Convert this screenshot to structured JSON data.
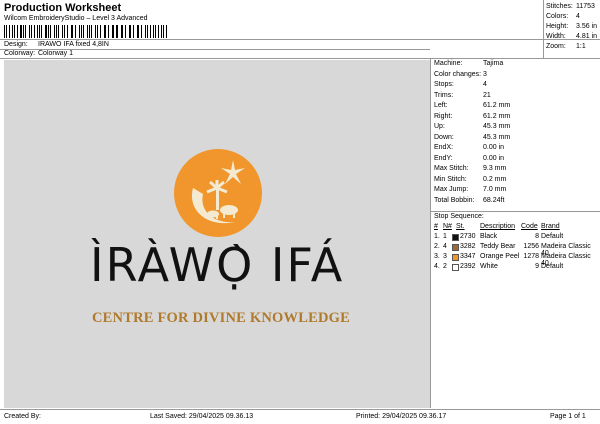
{
  "header": {
    "title": "Production Worksheet",
    "subtitle": "Wilcom EmbroideryStudio – Level 3 Advanced",
    "design_label": "Design:",
    "design_value": "IRAWO IFA fixed 4,8IN",
    "colorway_label": "Colorway:",
    "colorway_value": "Colorway 1"
  },
  "summary": [
    {
      "label": "Stitches:",
      "value": "11753"
    },
    {
      "label": "Colors:",
      "value": "4"
    },
    {
      "label": "Height:",
      "value": "3.56 in"
    },
    {
      "label": "Width:",
      "value": "4.81 in"
    },
    {
      "label": "Zoom:",
      "value": "1:1"
    }
  ],
  "design": {
    "logo_text": "ÌRÀWỌ̀ IFÁ",
    "tagline": "CENTRE FOR DIVINE KNOWLEDGE",
    "colors": {
      "orange": "#f0962c",
      "cream": "#f4ead2",
      "gold": "#b07a2c",
      "black": "#111111",
      "canvas": "#d8d8d8"
    }
  },
  "details": [
    {
      "label": "Machine:",
      "value": "Tajima"
    },
    {
      "label": "Color changes:",
      "value": "3"
    },
    {
      "label": "Stops:",
      "value": "4"
    },
    {
      "label": "Trims:",
      "value": "21"
    },
    {
      "label": "Left:",
      "value": "61.2 mm"
    },
    {
      "label": "Right:",
      "value": "61.2 mm"
    },
    {
      "label": "Up:",
      "value": "45.3 mm"
    },
    {
      "label": "Down:",
      "value": "45.3 mm"
    },
    {
      "label": "EndX:",
      "value": "0.00 in"
    },
    {
      "label": "EndY:",
      "value": "0.00 in"
    },
    {
      "label": "Max Stitch:",
      "value": "9.3 mm"
    },
    {
      "label": "Min Stitch:",
      "value": "0.2 mm"
    },
    {
      "label": "Max Jump:",
      "value": "7.0 mm"
    },
    {
      "label": "Total Bobbin:",
      "value": "68.24ft"
    }
  ],
  "stop_sequence": {
    "title": "Stop Sequence:",
    "columns": [
      "#",
      "N#",
      "St.",
      "Description",
      "Code",
      "Brand"
    ],
    "rows": [
      {
        "num": "1.",
        "n": "1",
        "color": "#111111",
        "st": "2730",
        "desc": "Black",
        "code": "8",
        "brand": "Default"
      },
      {
        "num": "2.",
        "n": "4",
        "color": "#9a6a3c",
        "st": "3282",
        "desc": "Teddy Bear",
        "code": "1256",
        "brand": "Madeira Classic 40"
      },
      {
        "num": "3.",
        "n": "3",
        "color": "#f0962c",
        "st": "3347",
        "desc": "Orange Peel",
        "code": "1278",
        "brand": "Madeira Classic 40"
      },
      {
        "num": "4.",
        "n": "2",
        "color": "#ffffff",
        "st": "2392",
        "desc": "White",
        "code": "9",
        "brand": "Default"
      }
    ]
  },
  "footer": {
    "created": "Created By:",
    "saved": "Last Saved: 29/04/2025 09.36.13",
    "printed": "Printed: 29/04/2025 09.36.17",
    "page": "Page 1 of 1"
  }
}
